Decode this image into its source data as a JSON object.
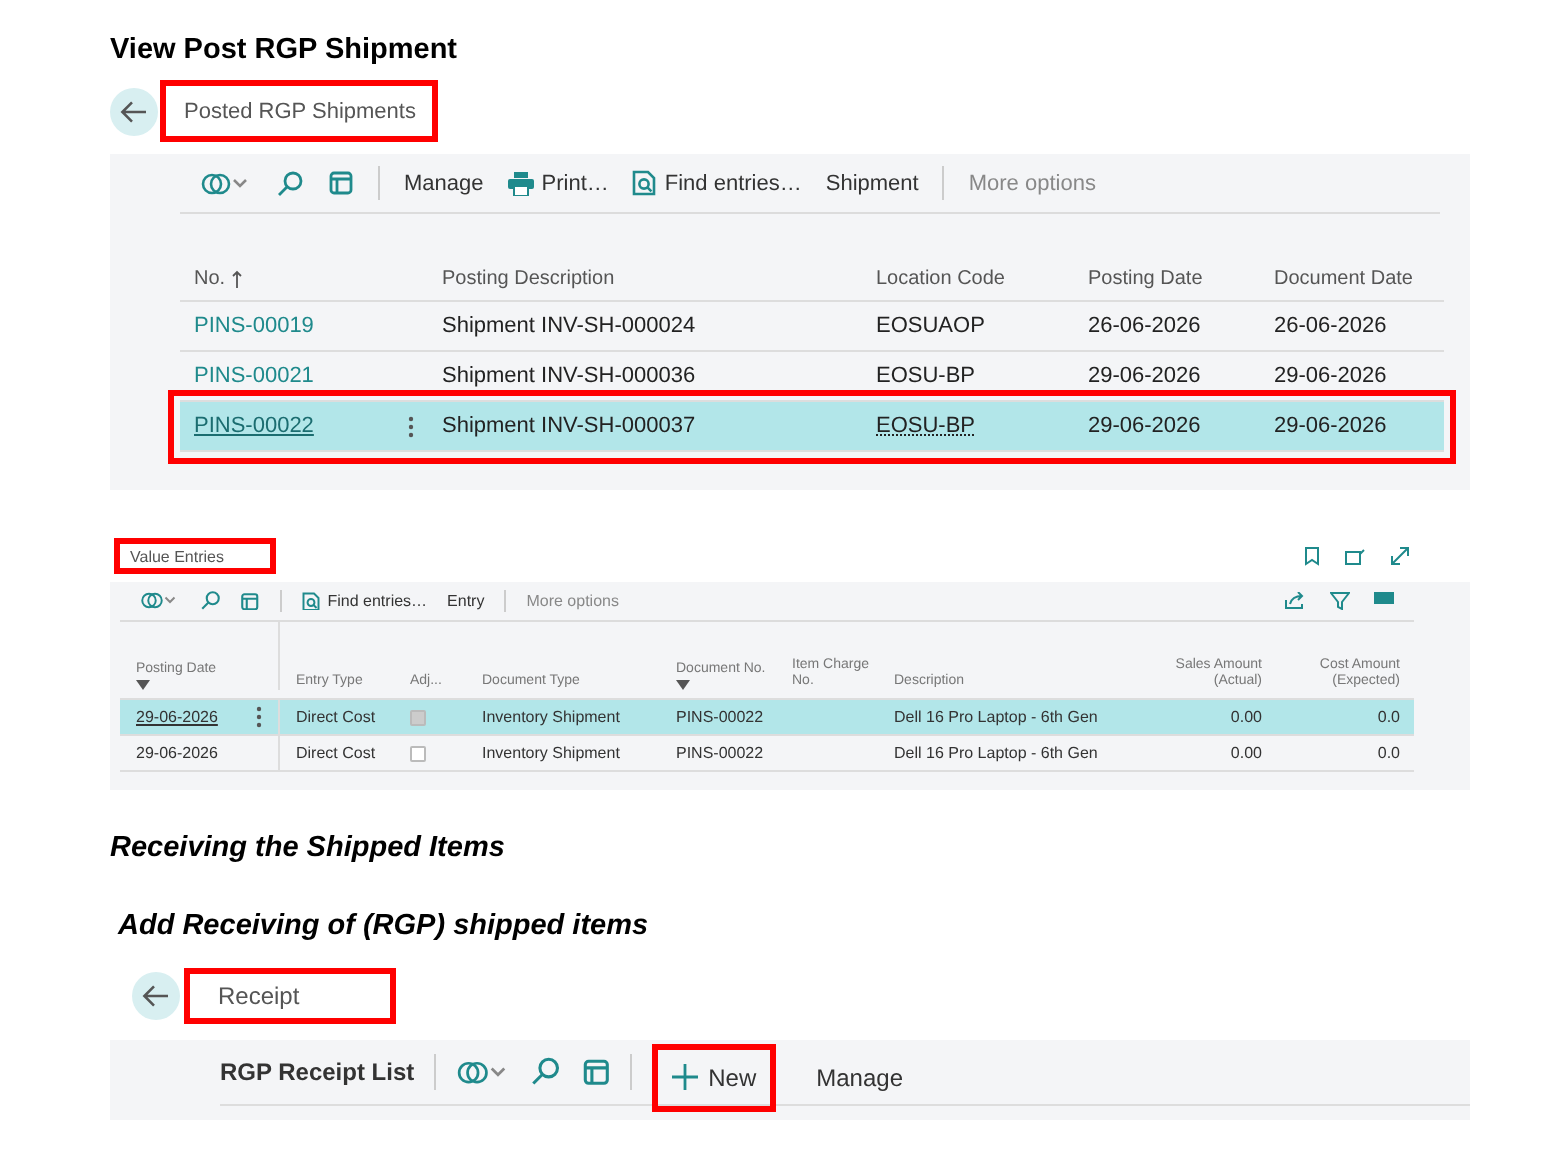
{
  "heading_view": "View Post RGP Shipment",
  "shipments_page": {
    "breadcrumb": {
      "label": "Posted RGP Shipments",
      "highlighted": true
    },
    "toolbar": [
      {
        "label": "Manage",
        "kind": "menu"
      },
      {
        "label": "Print…",
        "kind": "print"
      },
      {
        "label": "Find entries…",
        "kind": "find"
      },
      {
        "label": "Shipment",
        "kind": "action"
      },
      {
        "label": "More options",
        "kind": "more"
      }
    ],
    "columns": [
      {
        "label": "No.",
        "sorted": true
      },
      {
        "label": "Posting Description",
        "sorted": false
      },
      {
        "label": "Location Code",
        "sorted": false
      },
      {
        "label": "Posting Date",
        "sorted": false
      },
      {
        "label": "Document Date",
        "sorted": false
      }
    ],
    "rows": [
      {
        "cells": [
          "PINS-00019",
          "Shipment INV-SH-000024",
          "EOSUAOP",
          "26-06-2026",
          "26-06-2026"
        ],
        "selected": false,
        "highlighted": false
      },
      {
        "cells": [
          "PINS-00021",
          "Shipment INV-SH-000036",
          "EOSU-BP",
          "29-06-2026",
          "29-06-2026"
        ],
        "selected": false,
        "highlighted": false
      },
      {
        "cells": [
          "PINS-00022",
          "Shipment INV-SH-000037",
          "EOSU-BP",
          "29-06-2026",
          "29-06-2026"
        ],
        "selected": true,
        "highlighted": true
      }
    ]
  },
  "value_entries": {
    "title": {
      "label": "Value Entries",
      "highlighted": true
    },
    "toolbar": [
      {
        "label": "Find entries…",
        "kind": "find"
      },
      {
        "label": "Entry",
        "kind": "action"
      },
      {
        "label": "More options",
        "kind": "more"
      }
    ],
    "columns": [
      {
        "label": "Posting Date",
        "filtered": true,
        "kind": "text"
      },
      {
        "label": "Entry Type",
        "filtered": false,
        "kind": "text"
      },
      {
        "label": "Adj...",
        "filtered": false,
        "kind": "text"
      },
      {
        "label": "Document Type",
        "filtered": false,
        "kind": "text"
      },
      {
        "label": "Document No.",
        "filtered": true,
        "kind": "text"
      },
      {
        "label": "Item Charge No.",
        "filtered": false,
        "kind": "text"
      },
      {
        "label": "Description",
        "filtered": false,
        "kind": "text"
      },
      {
        "label": "Sales Amount (Actual)",
        "filtered": false,
        "kind": "amount"
      },
      {
        "label": "Cost Amount (Expected)",
        "filtered": false,
        "kind": "amount"
      }
    ],
    "rows": [
      {
        "posting_date": "29-06-2026",
        "entry_type": "Direct Cost",
        "adjusted": true,
        "document_type": "Inventory Shipment",
        "document_no": "PINS-00022",
        "description": "Dell 16 Pro Laptop - 6th Gen",
        "sales_amount": "0.00",
        "cost_amount": "0.0",
        "selected": true
      },
      {
        "posting_date": "29-06-2026",
        "entry_type": "Direct Cost",
        "adjusted": false,
        "document_type": "Inventory Shipment",
        "document_no": "PINS-00022",
        "description": "Dell 16 Pro Laptop - 6th Gen",
        "sales_amount": "0.00",
        "cost_amount": "0.0",
        "selected": false
      }
    ]
  },
  "heading_receiving": "Receiving the Shipped Items",
  "heading_add_receiving": "Add Receiving of (RGP) shipped items",
  "receipt_page": {
    "breadcrumb": {
      "label": "Receipt",
      "highlighted": true
    },
    "list_title": "RGP Receipt List",
    "toolbar": [
      {
        "label": "New",
        "kind": "new",
        "highlighted": true
      },
      {
        "label": "Manage",
        "kind": "menu",
        "highlighted": false
      }
    ]
  }
}
